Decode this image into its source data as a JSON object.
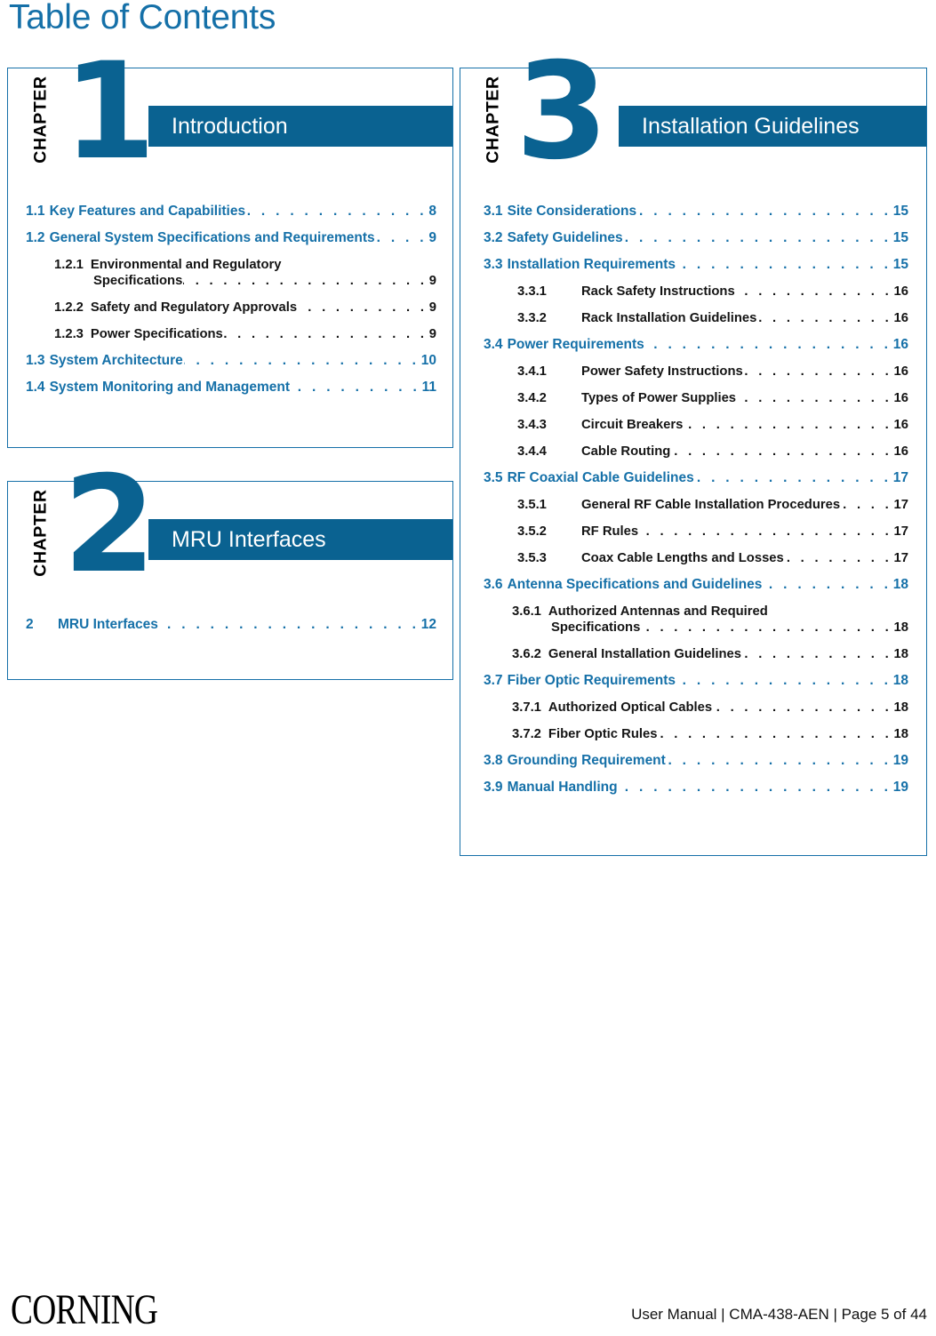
{
  "page_title": "Table of Contents",
  "colors": {
    "accent_blue": "#1570A8",
    "banner_blue": "#0A6291",
    "sub_black": "#141414"
  },
  "chapters": [
    {
      "chapter_label": "CHAPTER",
      "chapter_number": "1",
      "chapter_title": "Introduction",
      "entries": [
        {
          "level": 1,
          "number": "1.1",
          "title": "Key Features and Capabilities",
          "page": "8"
        },
        {
          "level": 1,
          "number": "1.2",
          "title": "General System Specifications and Requirements",
          "page": "9"
        },
        {
          "level": 2,
          "number": "1.2.1",
          "title": "Environmental and Regulatory",
          "title2": "Specifications",
          "page": "9"
        },
        {
          "level": 2,
          "number": "1.2.2",
          "title": "Safety and Regulatory Approvals",
          "page": "9"
        },
        {
          "level": 2,
          "number": "1.2.3",
          "title": "Power Specifications",
          "page": "9"
        },
        {
          "level": 1,
          "number": "1.3",
          "title": "System Architecture",
          "page": "10"
        },
        {
          "level": 1,
          "number": "1.4",
          "title": "System Monitoring and Management",
          "page": "11"
        }
      ]
    },
    {
      "chapter_label": "CHAPTER",
      "chapter_number": "2",
      "chapter_title": "MRU Interfaces",
      "entries": [
        {
          "level": 1,
          "number": "2",
          "title": "MRU Interfaces",
          "page": "12"
        }
      ]
    },
    {
      "chapter_label": "CHAPTER",
      "chapter_number": "3",
      "chapter_title": "Installation Guidelines",
      "entries": [
        {
          "level": 1,
          "number": "3.1",
          "title": "Site Considerations",
          "page": "15"
        },
        {
          "level": 1,
          "number": "3.2",
          "title": "Safety Guidelines",
          "page": "15"
        },
        {
          "level": 1,
          "number": "3.3",
          "title": "Installation Requirements",
          "page": "15"
        },
        {
          "level": 2,
          "number": "3.3.1",
          "title": "Rack Safety Instructions",
          "page": "16"
        },
        {
          "level": 2,
          "number": "3.3.2",
          "title": "Rack Installation Guidelines",
          "page": "16"
        },
        {
          "level": 1,
          "number": "3.4",
          "title": "Power Requirements",
          "page": "16"
        },
        {
          "level": 2,
          "number": "3.4.1",
          "title": "Power Safety Instructions",
          "page": "16"
        },
        {
          "level": 2,
          "number": "3.4.2",
          "title": "Types of Power Supplies",
          "page": "16"
        },
        {
          "level": 2,
          "number": "3.4.3",
          "title": "Circuit Breakers",
          "page": "16"
        },
        {
          "level": 2,
          "number": "3.4.4",
          "title": "Cable Routing",
          "page": "16"
        },
        {
          "level": 1,
          "number": "3.5",
          "title": "RF Coaxial Cable Guidelines",
          "page": "17"
        },
        {
          "level": 2,
          "number": "3.5.1",
          "title": "General RF Cable Installation Procedures",
          "page": "17"
        },
        {
          "level": 2,
          "number": "3.5.2",
          "title": "RF Rules",
          "page": "17"
        },
        {
          "level": 2,
          "number": "3.5.3",
          "title": "Coax Cable Lengths and Losses",
          "page": "17"
        },
        {
          "level": 1,
          "number": "3.6",
          "title": "Antenna Specifications and Guidelines",
          "page": "18"
        },
        {
          "level": 2,
          "number": "3.6.1",
          "title": "Authorized Antennas and Required",
          "title2": "Specifications",
          "page": "18"
        },
        {
          "level": 2,
          "number": "3.6.2",
          "title": "General Installation Guidelines",
          "page": "18"
        },
        {
          "level": 1,
          "number": "3.7",
          "title": "Fiber Optic Requirements",
          "page": "18"
        },
        {
          "level": 2,
          "number": "3.7.1",
          "title": "Authorized Optical Cables",
          "page": "18"
        },
        {
          "level": 2,
          "number": "3.7.2",
          "title": "Fiber Optic Rules",
          "page": "18"
        },
        {
          "level": 1,
          "number": "3.8",
          "title": "Grounding Requirement",
          "page": "19"
        },
        {
          "level": 1,
          "number": "3.9",
          "title": "Manual Handling",
          "page": "19"
        }
      ]
    }
  ],
  "footer": {
    "logo": "CORNING",
    "meta": "User Manual | CMA-438-AEN | Page 5 of 44"
  }
}
